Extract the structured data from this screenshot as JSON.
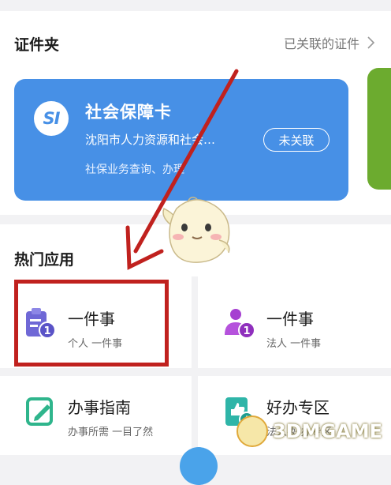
{
  "wallet": {
    "title": "证件夹",
    "linked_label": "已关联的证件",
    "card": {
      "logo_text": "SI",
      "title": "社会保障卡",
      "org": "沈阳市人力资源和社会…",
      "status": "未关联",
      "desc": "社保业务查询、办理",
      "color": "#4790e6"
    },
    "next_card_color": "#6cab2f"
  },
  "hot_apps": {
    "title": "热门应用",
    "items": [
      {
        "title": "一件事",
        "subtitle": "个人 一件事",
        "icon": "clipboard-badge-icon",
        "color": "#6f68d6"
      },
      {
        "title": "一件事",
        "subtitle": "法人 一件事",
        "icon": "people-badge-icon",
        "color": "#a63fd1"
      },
      {
        "title": "办事指南",
        "subtitle": "办事所需 一目了然",
        "icon": "edit-document-icon",
        "color": "#2fb58c"
      },
      {
        "title": "好办专区",
        "subtitle": "法人-好办专区",
        "icon": "thumbs-up-doc-icon",
        "color": "#2fb5a8"
      }
    ]
  },
  "annotation": {
    "arrow_color": "#c0211e",
    "highlight_color": "#c0211e"
  },
  "watermark": {
    "text": "3DMGAME"
  }
}
